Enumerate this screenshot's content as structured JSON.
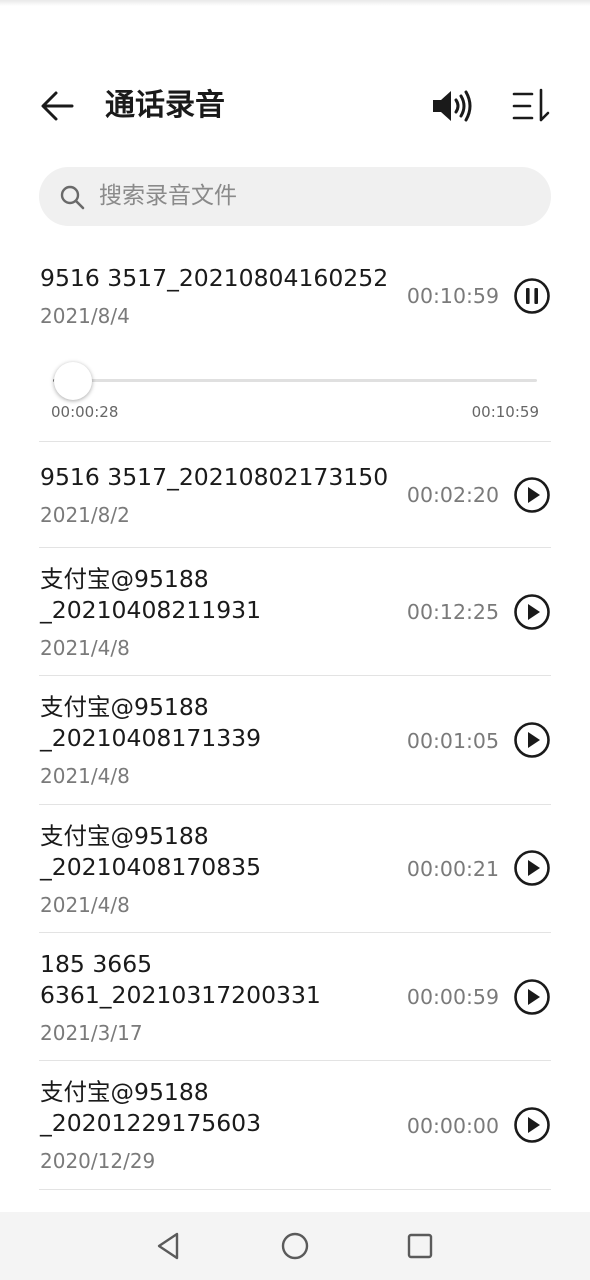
{
  "header": {
    "title": "通话录音"
  },
  "search": {
    "placeholder": "搜索录音文件"
  },
  "playing": {
    "current_time": "00:00:28",
    "total_time": "00:10:59",
    "progress_fraction": 0.042
  },
  "recordings": [
    {
      "name": "9516 3517_20210804160252",
      "date": "2021/8/4",
      "duration": "00:10:59",
      "state": "playing"
    },
    {
      "name": "9516 3517_20210802173150",
      "date": "2021/8/2",
      "duration": "00:02:20",
      "state": "stopped"
    },
    {
      "name": "支付宝@95188\n_20210408211931",
      "date": "2021/4/8",
      "duration": "00:12:25",
      "state": "stopped"
    },
    {
      "name": "支付宝@95188\n_20210408171339",
      "date": "2021/4/8",
      "duration": "00:01:05",
      "state": "stopped"
    },
    {
      "name": "支付宝@95188\n_20210408170835",
      "date": "2021/4/8",
      "duration": "00:00:21",
      "state": "stopped"
    },
    {
      "name": "185 3665\n6361_20210317200331",
      "date": "2021/3/17",
      "duration": "00:00:59",
      "state": "stopped"
    },
    {
      "name": "支付宝@95188\n_20201229175603",
      "date": "2020/12/29",
      "duration": "00:00:00",
      "state": "stopped"
    }
  ],
  "icons": {
    "back": "arrow-left-icon",
    "speaker": "speaker-icon",
    "sort": "sort-icon",
    "search": "search-icon",
    "pause": "pause-icon",
    "play": "play-icon",
    "nav_back": "triangle-back-icon",
    "nav_home": "circle-home-icon",
    "nav_recent": "square-recent-icon"
  }
}
